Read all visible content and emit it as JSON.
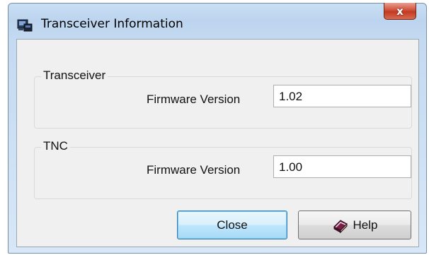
{
  "window": {
    "title": "Transceiver Information",
    "close_glyph": "x",
    "icon": "transceiver-app-icon"
  },
  "groups": [
    {
      "title": "Transceiver",
      "field_label": "Firmware Version",
      "field_value": "1.02"
    },
    {
      "title": "TNC",
      "field_label": "Firmware Version",
      "field_value": "1.00"
    }
  ],
  "buttons": {
    "close_label": "Close",
    "help_label": "Help",
    "help_icon": "help-book-icon"
  },
  "colors": {
    "title_bar": "#bcd4ee",
    "close_button": "#c8452c",
    "dialog_background": "#f0f0f0",
    "focused_button_border": "#3c7fb1"
  }
}
